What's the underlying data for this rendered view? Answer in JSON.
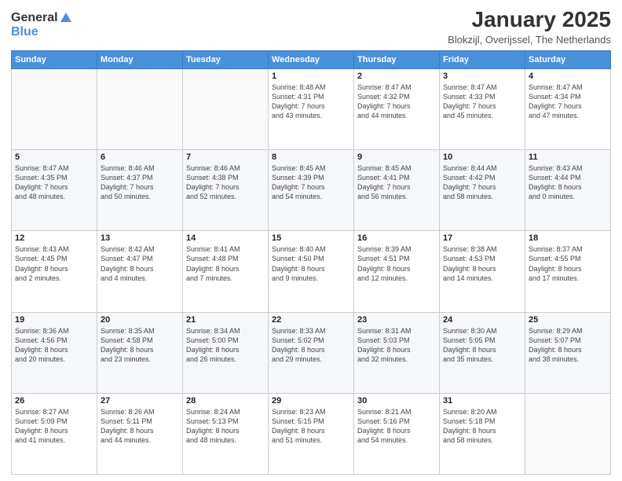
{
  "logo": {
    "general": "General",
    "blue": "Blue"
  },
  "title": "January 2025",
  "subtitle": "Blokzijl, Overijssel, The Netherlands",
  "weekdays": [
    "Sunday",
    "Monday",
    "Tuesday",
    "Wednesday",
    "Thursday",
    "Friday",
    "Saturday"
  ],
  "weeks": [
    [
      {
        "day": "",
        "info": ""
      },
      {
        "day": "",
        "info": ""
      },
      {
        "day": "",
        "info": ""
      },
      {
        "day": "1",
        "info": "Sunrise: 8:48 AM\nSunset: 4:31 PM\nDaylight: 7 hours\nand 43 minutes."
      },
      {
        "day": "2",
        "info": "Sunrise: 8:47 AM\nSunset: 4:32 PM\nDaylight: 7 hours\nand 44 minutes."
      },
      {
        "day": "3",
        "info": "Sunrise: 8:47 AM\nSunset: 4:33 PM\nDaylight: 7 hours\nand 45 minutes."
      },
      {
        "day": "4",
        "info": "Sunrise: 8:47 AM\nSunset: 4:34 PM\nDaylight: 7 hours\nand 47 minutes."
      }
    ],
    [
      {
        "day": "5",
        "info": "Sunrise: 8:47 AM\nSunset: 4:35 PM\nDaylight: 7 hours\nand 48 minutes."
      },
      {
        "day": "6",
        "info": "Sunrise: 8:46 AM\nSunset: 4:37 PM\nDaylight: 7 hours\nand 50 minutes."
      },
      {
        "day": "7",
        "info": "Sunrise: 8:46 AM\nSunset: 4:38 PM\nDaylight: 7 hours\nand 52 minutes."
      },
      {
        "day": "8",
        "info": "Sunrise: 8:45 AM\nSunset: 4:39 PM\nDaylight: 7 hours\nand 54 minutes."
      },
      {
        "day": "9",
        "info": "Sunrise: 8:45 AM\nSunset: 4:41 PM\nDaylight: 7 hours\nand 56 minutes."
      },
      {
        "day": "10",
        "info": "Sunrise: 8:44 AM\nSunset: 4:42 PM\nDaylight: 7 hours\nand 58 minutes."
      },
      {
        "day": "11",
        "info": "Sunrise: 8:43 AM\nSunset: 4:44 PM\nDaylight: 8 hours\nand 0 minutes."
      }
    ],
    [
      {
        "day": "12",
        "info": "Sunrise: 8:43 AM\nSunset: 4:45 PM\nDaylight: 8 hours\nand 2 minutes."
      },
      {
        "day": "13",
        "info": "Sunrise: 8:42 AM\nSunset: 4:47 PM\nDaylight: 8 hours\nand 4 minutes."
      },
      {
        "day": "14",
        "info": "Sunrise: 8:41 AM\nSunset: 4:48 PM\nDaylight: 8 hours\nand 7 minutes."
      },
      {
        "day": "15",
        "info": "Sunrise: 8:40 AM\nSunset: 4:50 PM\nDaylight: 8 hours\nand 9 minutes."
      },
      {
        "day": "16",
        "info": "Sunrise: 8:39 AM\nSunset: 4:51 PM\nDaylight: 8 hours\nand 12 minutes."
      },
      {
        "day": "17",
        "info": "Sunrise: 8:38 AM\nSunset: 4:53 PM\nDaylight: 8 hours\nand 14 minutes."
      },
      {
        "day": "18",
        "info": "Sunrise: 8:37 AM\nSunset: 4:55 PM\nDaylight: 8 hours\nand 17 minutes."
      }
    ],
    [
      {
        "day": "19",
        "info": "Sunrise: 8:36 AM\nSunset: 4:56 PM\nDaylight: 8 hours\nand 20 minutes."
      },
      {
        "day": "20",
        "info": "Sunrise: 8:35 AM\nSunset: 4:58 PM\nDaylight: 8 hours\nand 23 minutes."
      },
      {
        "day": "21",
        "info": "Sunrise: 8:34 AM\nSunset: 5:00 PM\nDaylight: 8 hours\nand 26 minutes."
      },
      {
        "day": "22",
        "info": "Sunrise: 8:33 AM\nSunset: 5:02 PM\nDaylight: 8 hours\nand 29 minutes."
      },
      {
        "day": "23",
        "info": "Sunrise: 8:31 AM\nSunset: 5:03 PM\nDaylight: 8 hours\nand 32 minutes."
      },
      {
        "day": "24",
        "info": "Sunrise: 8:30 AM\nSunset: 5:05 PM\nDaylight: 8 hours\nand 35 minutes."
      },
      {
        "day": "25",
        "info": "Sunrise: 8:29 AM\nSunset: 5:07 PM\nDaylight: 8 hours\nand 38 minutes."
      }
    ],
    [
      {
        "day": "26",
        "info": "Sunrise: 8:27 AM\nSunset: 5:09 PM\nDaylight: 8 hours\nand 41 minutes."
      },
      {
        "day": "27",
        "info": "Sunrise: 8:26 AM\nSunset: 5:11 PM\nDaylight: 8 hours\nand 44 minutes."
      },
      {
        "day": "28",
        "info": "Sunrise: 8:24 AM\nSunset: 5:13 PM\nDaylight: 8 hours\nand 48 minutes."
      },
      {
        "day": "29",
        "info": "Sunrise: 8:23 AM\nSunset: 5:15 PM\nDaylight: 8 hours\nand 51 minutes."
      },
      {
        "day": "30",
        "info": "Sunrise: 8:21 AM\nSunset: 5:16 PM\nDaylight: 8 hours\nand 54 minutes."
      },
      {
        "day": "31",
        "info": "Sunrise: 8:20 AM\nSunset: 5:18 PM\nDaylight: 8 hours\nand 58 minutes."
      },
      {
        "day": "",
        "info": ""
      }
    ]
  ]
}
